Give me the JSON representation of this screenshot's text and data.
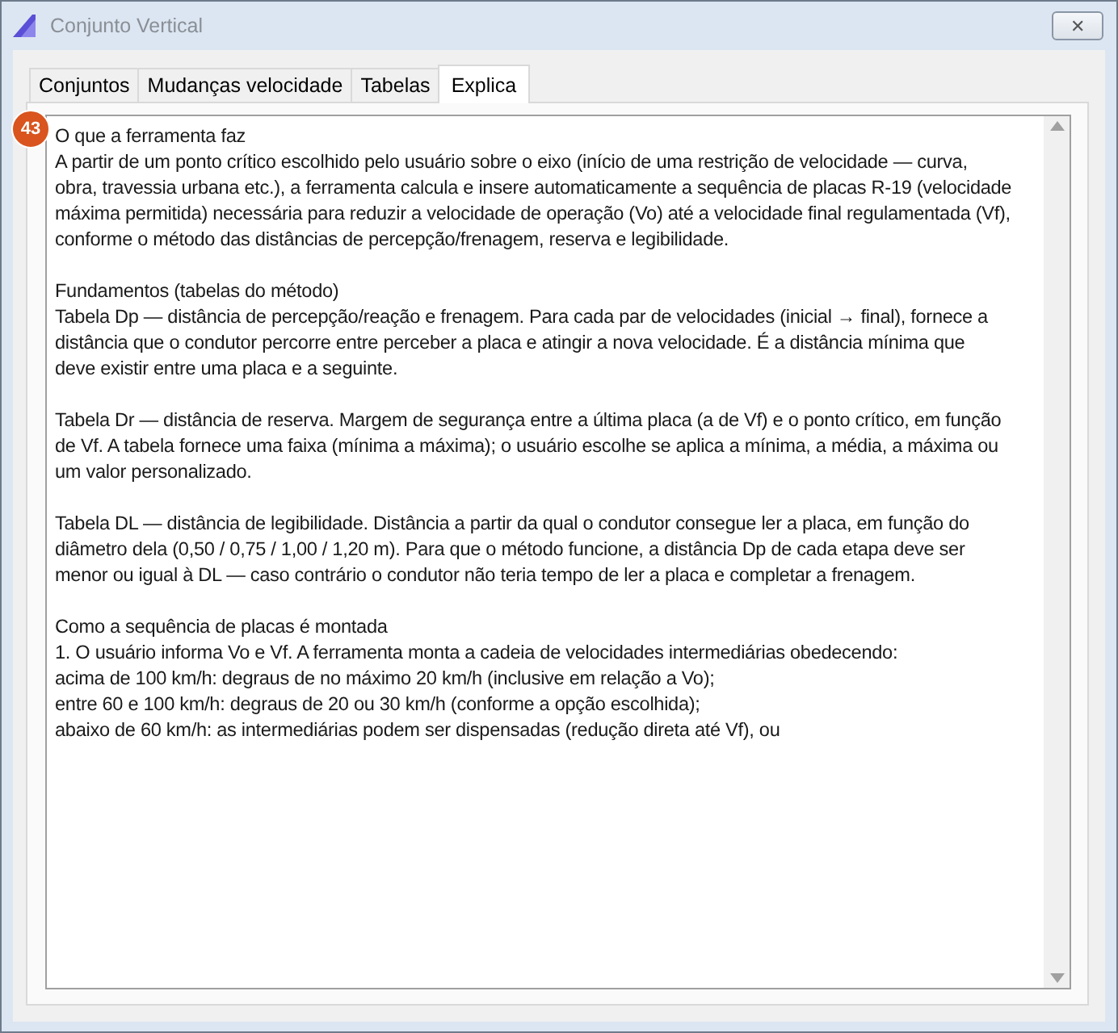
{
  "window": {
    "title": "Conjunto Vertical",
    "close": "✕"
  },
  "tabs": [
    {
      "label": "Conjuntos",
      "selected": false
    },
    {
      "label": "Mudanças velocidade",
      "selected": false
    },
    {
      "label": "Tabelas",
      "selected": false
    },
    {
      "label": "Explica",
      "selected": true
    }
  ],
  "badge": "43",
  "text": {
    "paragraphs": [
      {
        "lines": [
          "O que a ferramenta faz",
          "A partir de um ponto crítico escolhido pelo usuário sobre o eixo (início de uma restrição de velocidade — curva,",
          "obra, travessia urbana etc.), a ferramenta calcula e insere automaticamente a sequência de placas R-19 (velocidade",
          "máxima permitida) necessária para reduzir a velocidade de operação (Vo) até a velocidade final regulamentada (Vf),",
          "conforme o método das distâncias de percepção/frenagem, reserva e legibilidade."
        ]
      },
      {
        "lines": [
          "Fundamentos (tabelas do método)",
          "Tabela Dp — distância de percepção/reação e frenagem. Para cada par de velocidades (inicial → final), fornece a",
          "distância que o condutor percorre entre perceber a placa e atingir a nova velocidade. É a distância mínima que",
          "deve existir entre uma placa e a seguinte."
        ]
      },
      {
        "lines": [
          "Tabela Dr — distância de reserva. Margem de segurança entre a última placa (a de Vf) e o ponto crítico, em função",
          "de Vf. A tabela fornece uma faixa (mínima a máxima); o usuário escolhe se aplica a mínima, a média, a máxima ou",
          "um valor personalizado."
        ]
      },
      {
        "lines": [
          "Tabela DL — distância de legibilidade. Distância a partir da qual o condutor consegue ler a placa, em função do",
          "diâmetro dela (0,50 / 0,75 / 1,00 / 1,20 m). Para que o método funcione, a distância Dp de cada etapa deve ser",
          "menor ou igual à DL — caso contrário o condutor não teria tempo de ler a placa e completar a frenagem."
        ]
      },
      {
        "lines": [
          "Como a sequência de placas é montada",
          "1. O usuário informa Vo e Vf. A ferramenta monta a cadeia de velocidades intermediárias obedecendo:",
          "acima de 100 km/h: degraus de no máximo 20 km/h (inclusive em relação a Vo);",
          "entre 60 e 100 km/h: degraus de 20 ou 30 km/h (conforme a opção escolhida);",
          "abaixo de 60 km/h: as intermediárias podem ser dispensadas (redução direta até Vf), ou"
        ]
      }
    ]
  }
}
